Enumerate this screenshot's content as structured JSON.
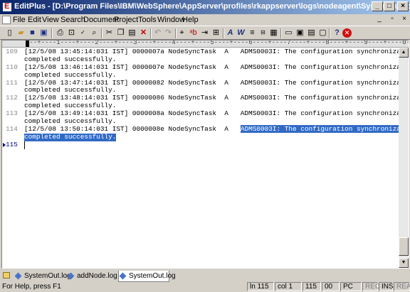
{
  "window": {
    "title": "EditPlus - [D:\\Program Files\\IBM\\WebSphere\\AppServer\\profiles\\rkappserver\\logs\\nodeagent\\SystemOut.log]"
  },
  "menu": {
    "items": [
      "File",
      "Edit",
      "View",
      "Search",
      "Document",
      "Project",
      "Tools",
      "Window",
      "Help"
    ]
  },
  "toolbar": {
    "icons": [
      "new-file-icon",
      "open-folder-icon",
      "save-icon",
      "save-all-icon",
      "print-icon",
      "print-preview-icon",
      "spell-check-icon",
      "find-icon",
      "cut-icon",
      "copy-icon",
      "paste-icon",
      "delete-icon",
      "undo-icon",
      "redo-icon",
      "find-replace-icon",
      "replace-icon",
      "go-to-icon",
      "screen-icon",
      "font-icon",
      "word-wrap-icon",
      "line-numbers-icon",
      "ruler-icon",
      "html-icon",
      "browser-icon",
      "view-icon",
      "dir-icon",
      "help-icon",
      "stop-icon"
    ]
  },
  "editor": {
    "ruler": "---+----1----+----2----+----3----+----4----+----5----+----6----+----7----+----8----+----9----+----0---",
    "lines": [
      {
        "num": "109",
        "text": "[12/5/08 13:45:14:031 IST] 0000007a NodeSyncTask  A   ADMS0003I: The configuration synchronization",
        "cont": "completed successfully."
      },
      {
        "num": "110",
        "text": "[12/5/08 13:46:14:031 IST] 0000007e NodeSyncTask  A   ADMS0003I: The configuration synchronization",
        "cont": "completed successfully."
      },
      {
        "num": "111",
        "text": "[12/5/08 13:47:14:031 IST] 00000082 NodeSyncTask  A   ADMS0003I: The configuration synchronization",
        "cont": "completed successfully."
      },
      {
        "num": "112",
        "text": "[12/5/08 13:48:14:031 IST] 00000086 NodeSyncTask  A   ADMS0003I: The configuration synchronization",
        "cont": "completed successfully."
      },
      {
        "num": "113",
        "text": "[12/5/08 13:49:14:031 IST] 0000008a NodeSyncTask  A   ADMS0003I: The configuration synchronization",
        "cont": "completed successfully."
      },
      {
        "num": "114",
        "text": "[12/5/08 13:50:14:031 IST] 0000008e NodeSyncTask  A   ",
        "sel": "ADMS0003I: The configuration synchronization",
        "cont": "completed successfully."
      }
    ],
    "current_line": "115"
  },
  "tabs": [
    "SystemOut.log",
    "addNode.log",
    "SystemOut.log"
  ],
  "status": {
    "help": "For Help, press F1",
    "ln": "ln 115",
    "col": "col 1",
    "total": "115",
    "chars": "00",
    "mode": "PC",
    "rec": "REC",
    "ins": "INS",
    "read": "READ"
  }
}
